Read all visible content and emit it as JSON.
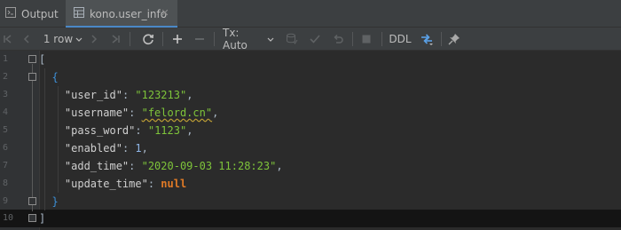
{
  "tabs": {
    "output_label": "Output",
    "active_label": "kono.user_info",
    "close_glyph": "✕"
  },
  "toolbar": {
    "rows_label": "1 row",
    "tx_label": "Tx: Auto",
    "ddl_label": "DDL"
  },
  "editor": {
    "line_numbers": [
      "1",
      "2",
      "3",
      "4",
      "5",
      "6",
      "7",
      "8",
      "9",
      "10"
    ],
    "open_bracket": "[",
    "open_brace": "{",
    "close_brace": "}",
    "close_bracket": "]",
    "fields": [
      {
        "key": "\"user_id\"",
        "value": "\"123213\"",
        "type": "string"
      },
      {
        "key": "\"username\"",
        "value": "\"felord.cn\"",
        "type": "string"
      },
      {
        "key": "\"pass_word\"",
        "value": "\"1123\"",
        "type": "string"
      },
      {
        "key": "\"enabled\"",
        "value": "1",
        "type": "number"
      },
      {
        "key": "\"add_time\"",
        "value": "\"2020-09-03 11:28:23\"",
        "type": "string"
      },
      {
        "key": "\"update_time\"",
        "value": "null",
        "type": "null"
      }
    ]
  },
  "colors": {
    "background": "#2b2b2b",
    "toolbar": "#3c3f41",
    "string": "#7ec43a",
    "number": "#8fb6e8",
    "null": "#e07a26",
    "brace": "#3d8fd6",
    "active_tab_underline": "#4a88c7"
  }
}
